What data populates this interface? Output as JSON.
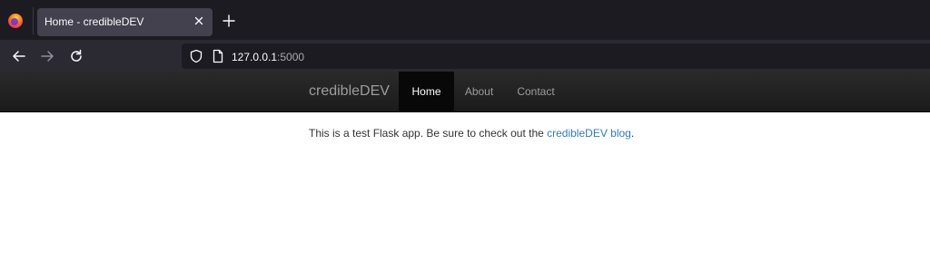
{
  "browser": {
    "tab": {
      "title": "Home - credibleDEV"
    },
    "url": {
      "host": "127.0.0.1",
      "port": ":5000"
    },
    "icons": {
      "logo": "firefox-logo-icon",
      "close": "close-icon",
      "new_tab": "plus-icon",
      "back": "back-arrow-icon",
      "forward": "forward-arrow-icon",
      "reload": "reload-icon",
      "shield": "shield-icon",
      "page": "page-icon"
    }
  },
  "site": {
    "brand": "credibleDEV",
    "nav": [
      {
        "label": "Home",
        "active": true
      },
      {
        "label": "About",
        "active": false
      },
      {
        "label": "Contact",
        "active": false
      }
    ],
    "content": {
      "text_before": "This is a test Flask app. Be sure to check out the ",
      "link_text": "credibleDEV blog",
      "text_after": "."
    },
    "colors": {
      "navbar_bg": "#222222",
      "nav_active_bg": "#080808",
      "link": "#337ab7",
      "text": "#333333"
    }
  }
}
